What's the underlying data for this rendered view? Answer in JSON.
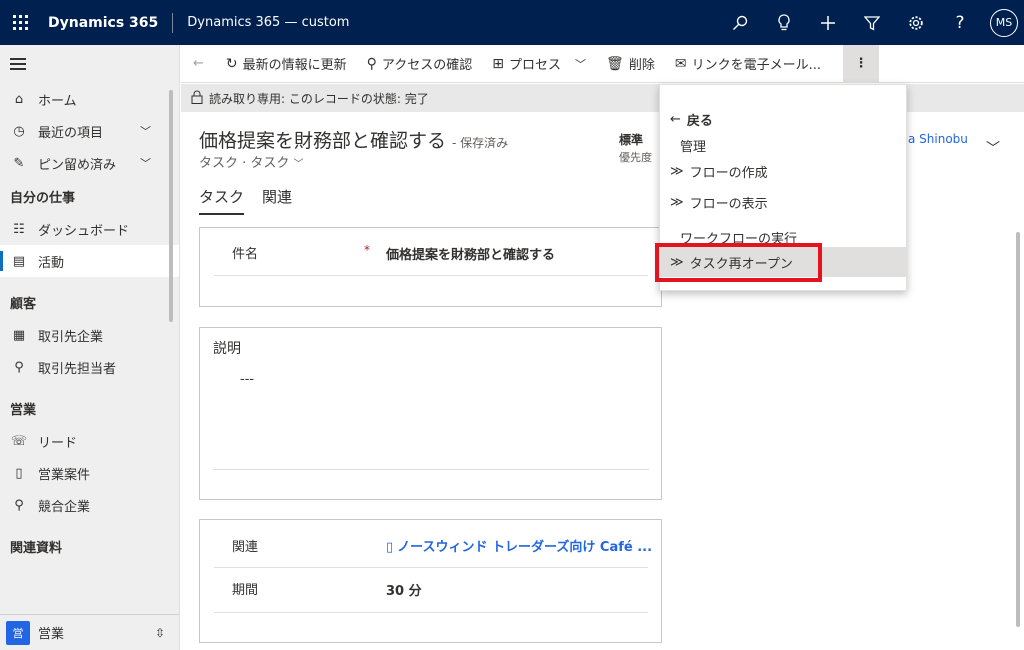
{
  "topbar": {
    "brand": "Dynamics 365",
    "app_name": "Dynamics 365 — custom",
    "icons": [
      "search-icon",
      "lightbulb-icon",
      "plus-icon",
      "filter-icon",
      "gear-icon",
      "help-icon"
    ],
    "avatar_initials": "MS",
    "bg_color": "#002050"
  },
  "sidebar": {
    "items_top": [
      {
        "label": "ホーム",
        "icon": "home-icon"
      },
      {
        "label": "最近の項目",
        "icon": "clock-icon"
      },
      {
        "label": "ピン留め済み",
        "icon": "pin-icon"
      }
    ],
    "sections": [
      {
        "title": "自分の仕事",
        "items": [
          {
            "label": "ダッシュボード"
          },
          {
            "label": "活動"
          }
        ]
      },
      {
        "title": "顧客",
        "items": [
          {
            "label": "取引先企業"
          },
          {
            "label": "取引先担当者"
          }
        ]
      },
      {
        "title": "営業",
        "items": [
          {
            "label": "リード"
          },
          {
            "label": "営業案件"
          },
          {
            "label": "競合企業"
          }
        ]
      },
      {
        "title": "関連資料",
        "items": []
      }
    ],
    "area": {
      "badge": "営",
      "label": "営業"
    }
  },
  "commandbar": {
    "refresh": "最新の情報に更新",
    "access": "アクセスの確認",
    "process": "プロセス",
    "delete": "削除",
    "email_link": "リンクを電子メール...",
    "more": "⋮"
  },
  "notification": "読み取り専用: このレコードの状態: 完了",
  "form": {
    "title": "価格提案を財務部と確認する",
    "saved": "- 保存済み",
    "subtitle": "タスク · タスク",
    "priority_value": "標準",
    "priority_label": "優先度",
    "owner": "a Shinobu",
    "tabs": [
      "タスク",
      "関連"
    ]
  },
  "fields": {
    "subject_label": "件名",
    "required_mark": "*",
    "subject_value": "価格提案を財務部と確認する",
    "description_title": "説明",
    "description_value": "---",
    "regarding_label": "関連",
    "regarding_value": "ノースウィンド トレーダーズ向け Café ...",
    "duration_label": "期間",
    "duration_value": "30 分"
  },
  "dropdown": {
    "back": "戻る",
    "manage": "管理",
    "create_flow": "フローの作成",
    "view_flow": "フローの表示",
    "run_workflow": "ワークフローの実行",
    "reopen_task": "タスク再オープン"
  },
  "highlight_color": "#e3131f"
}
